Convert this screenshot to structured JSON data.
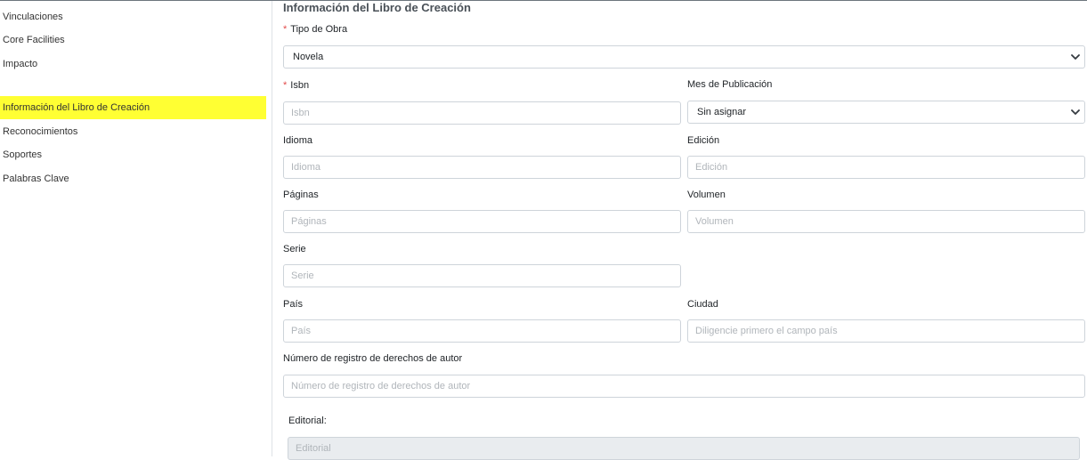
{
  "sidebar": {
    "items": [
      {
        "label": "Vinculaciones"
      },
      {
        "label": "Core Facilities"
      },
      {
        "label": "Impacto"
      },
      {
        "label": "Información del Libro de Creación"
      },
      {
        "label": "Reconocimientos"
      },
      {
        "label": "Soportes"
      },
      {
        "label": "Palabras Clave"
      }
    ],
    "active_color": "#ffff33"
  },
  "form": {
    "title": "Información del Libro de Creación",
    "required_mark": "*",
    "tipo_obra": {
      "label": "Tipo de Obra",
      "value": "Novela"
    },
    "isbn": {
      "label": "Isbn",
      "placeholder": "Isbn"
    },
    "mes_publicacion": {
      "label": "Mes de Publicación",
      "value": "Sin asignar"
    },
    "idioma": {
      "label": "Idioma",
      "placeholder": "Idioma"
    },
    "edicion": {
      "label": "Edición",
      "placeholder": "Edición"
    },
    "paginas": {
      "label": "Páginas",
      "placeholder": "Páginas"
    },
    "volumen": {
      "label": "Volumen",
      "placeholder": "Volumen"
    },
    "serie": {
      "label": "Serie",
      "placeholder": "Serie"
    },
    "pais": {
      "label": "País",
      "placeholder": "País"
    },
    "ciudad": {
      "label": "Ciudad",
      "placeholder": "Diligencie primero el campo país"
    },
    "registro_derechos": {
      "label": "Número de registro de derechos de autor",
      "placeholder": "Número de registro de derechos de autor"
    },
    "editorial": {
      "label": "Editorial:",
      "placeholder": "Editorial"
    }
  },
  "icons": {
    "select_chevron": "chevron-down-icon"
  }
}
